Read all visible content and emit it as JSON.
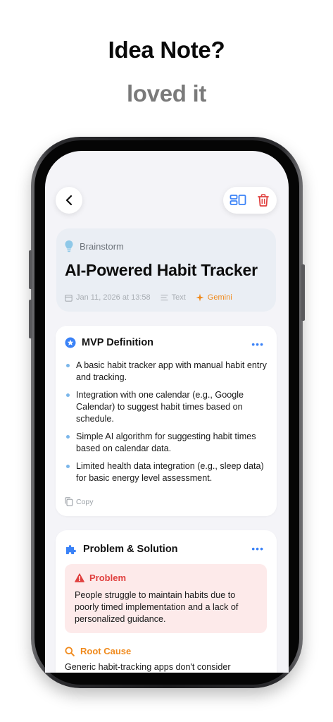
{
  "headline": {
    "line1": "Idea Note?",
    "line2": "loved it"
  },
  "nav": {
    "back_label": "Back"
  },
  "note": {
    "category": "Brainstorm",
    "title": "AI-Powered Habit Tracker",
    "date": "Jan 11, 2026 at 13:58",
    "type": "Text",
    "source": "Gemini"
  },
  "mvp": {
    "heading": "MVP Definition",
    "more": "•••",
    "items": [
      "A basic habit tracker app with manual habit entry and tracking.",
      "Integration with one calendar (e.g., Google Calendar) to suggest habit times based on schedule.",
      "Simple AI algorithm for suggesting habit times based on calendar data.",
      "Limited health data integration (e.g., sleep data) for basic energy level assessment."
    ],
    "copy_label": "Copy"
  },
  "problem_solution": {
    "heading": "Problem & Solution",
    "more": "•••",
    "problem_heading": "Problem",
    "problem_text": "People struggle to maintain habits due to poorly timed implementation and a lack of personalized guidance.",
    "root_heading": "Root Cause",
    "root_text": "Generic habit-tracking apps don't consider"
  },
  "colors": {
    "accent": "#3a82f7",
    "danger": "#e0403f",
    "warning": "#f08a1c",
    "bullet": "#7ab6ea"
  }
}
